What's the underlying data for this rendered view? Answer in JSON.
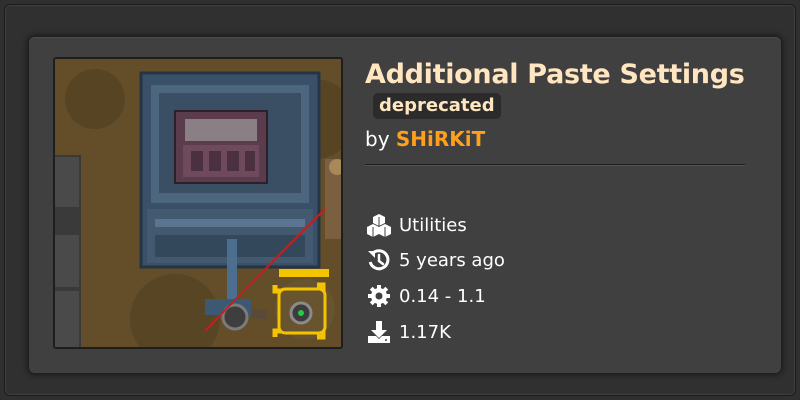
{
  "mod": {
    "title": "Additional Paste Settings",
    "badge": "deprecated",
    "author_prefix": "by",
    "author": "SHiRKiT"
  },
  "meta": {
    "category": "Utilities",
    "updated": "5 years ago",
    "versions": "0.14 - 1.1",
    "downloads": "1.17K"
  },
  "icons": {
    "category": "cubes-icon",
    "updated": "history-icon",
    "versions": "gear-icon",
    "downloads": "download-icon"
  },
  "colors": {
    "title": "#ffe6c0",
    "author": "#ff9f1b",
    "card": "#414041",
    "badge_bg": "#2b2b2b"
  }
}
